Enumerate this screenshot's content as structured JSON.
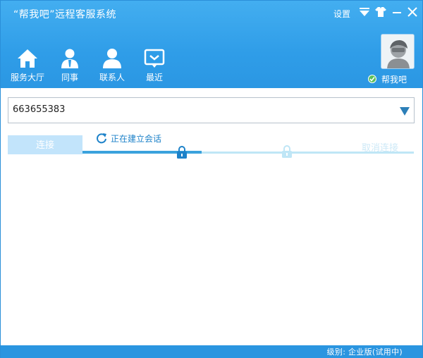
{
  "window": {
    "title": "“帮我吧”远程客服系统"
  },
  "top_controls": {
    "settings_label": "设置",
    "icons": [
      "dropdown-icon",
      "shirt-icon",
      "minimize-icon",
      "close-icon"
    ]
  },
  "nav": {
    "items": [
      {
        "label": "服务大厅",
        "icon": "home-icon"
      },
      {
        "label": "同事",
        "icon": "colleague-icon"
      },
      {
        "label": "联系人",
        "icon": "contact-icon"
      },
      {
        "label": "最近",
        "icon": "recent-chat-icon"
      }
    ]
  },
  "user": {
    "name": "帮我吧",
    "status_icon": "online-check-icon"
  },
  "connection": {
    "id_value": "663655383",
    "connect_label": "连接",
    "status_text": "正在建立会话",
    "cancel_label": "取消连接",
    "progress": 0.36
  },
  "footer": {
    "text": "级别: 企业版(试用中)"
  },
  "colors": {
    "header": "#2f9de8",
    "accent": "#3aa2dd",
    "button_disabled": "#c2e4fb"
  }
}
